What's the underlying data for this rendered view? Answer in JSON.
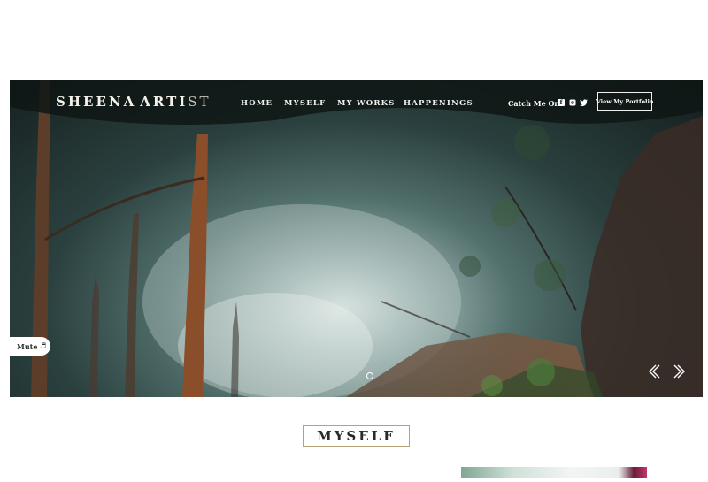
{
  "brand": {
    "word1": "SHEENA",
    "word2_main": "ARTI",
    "word2_tail": "ST"
  },
  "nav": {
    "items": [
      "HOME",
      "MYSELF",
      "MY WORKS",
      "HAPPENINGS"
    ]
  },
  "social": {
    "label": "Catch Me On :",
    "icons": [
      "facebook-icon",
      "instagram-icon",
      "twitter-icon"
    ]
  },
  "portfolio_button": "View My Portfolio",
  "mute_button": {
    "label": "Mute",
    "icon": "♬"
  },
  "slider": {
    "dot_icon": "slide-dot",
    "prev_icon": "prev-arrow-icon",
    "next_icon": "next-arrow-icon"
  },
  "section": {
    "title": "MYSELF"
  }
}
